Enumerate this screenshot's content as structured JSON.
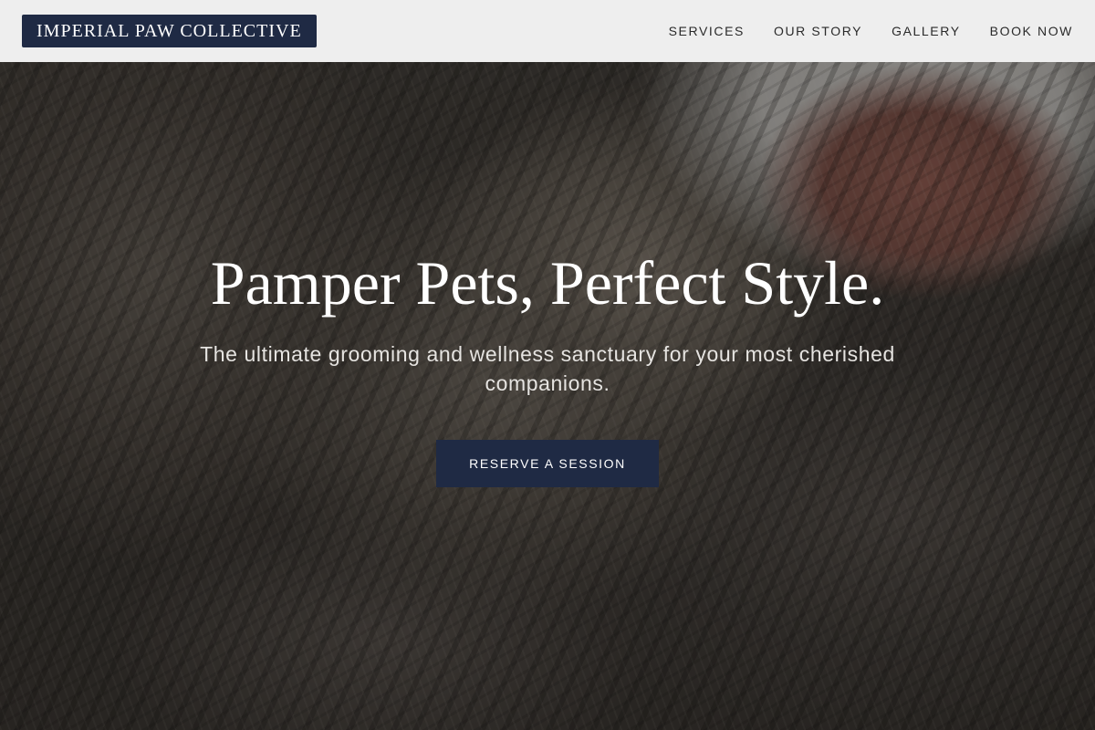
{
  "header": {
    "logo_text": "IMPERIAL PAW COLLECTIVE",
    "nav": [
      {
        "label": "SERVICES"
      },
      {
        "label": "OUR STORY"
      },
      {
        "label": "GALLERY"
      },
      {
        "label": "BOOK NOW"
      }
    ]
  },
  "hero": {
    "headline": "Pamper Pets, Perfect Style.",
    "subheadline": "The ultimate grooming and wellness sanctuary for your most cherished companions.",
    "cta_label": "RESERVE A SESSION"
  },
  "colors": {
    "brand_navy": "#1f2a44",
    "header_bg": "#eeeeee",
    "text_light": "#ffffff"
  }
}
